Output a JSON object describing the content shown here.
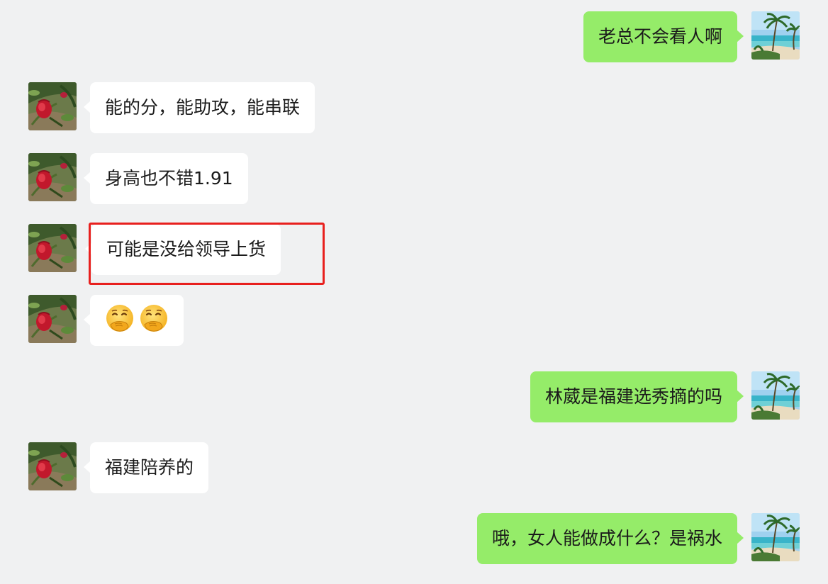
{
  "messages": [
    {
      "side": "right",
      "text": "老总不会看人啊"
    },
    {
      "side": "left",
      "text": "能的分，能助攻，能串联"
    },
    {
      "side": "left",
      "text": "身高也不错1.91"
    },
    {
      "side": "left",
      "text": "可能是没给领导上货"
    },
    {
      "side": "left",
      "emoji": [
        "hand-over-mouth-emoji",
        "hand-over-mouth-emoji"
      ]
    },
    {
      "side": "right",
      "text": "林葳是福建选秀摘的吗"
    },
    {
      "side": "left",
      "text": "福建陪养的"
    },
    {
      "side": "right",
      "text": "哦，女人能做成什么？是祸水"
    }
  ],
  "colors": {
    "background": "#f0f1f2",
    "sent_bubble": "#95ec69",
    "received_bubble": "#ffffff",
    "highlight_border": "#e8201e"
  },
  "highlighted_message_index": 3
}
